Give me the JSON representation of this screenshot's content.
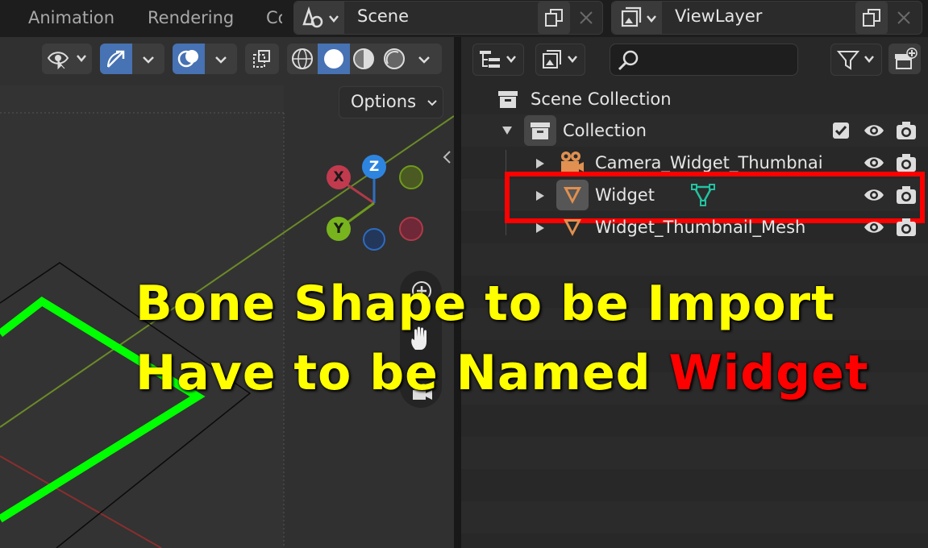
{
  "topbar": {
    "workspace_tabs": [
      "Animation",
      "Rendering",
      "Co"
    ],
    "scene": {
      "icon": "scene-icon",
      "name": "Scene"
    },
    "view_layer": {
      "icon": "view-layer-icon",
      "name": "ViewLayer"
    }
  },
  "viewport": {
    "options_label": "Options",
    "gizmo": {
      "x": "X",
      "y": "Y",
      "z": "Z"
    },
    "colors": {
      "grid_y_axis": "#7a9a2a",
      "grid_x_axis": "#a03030",
      "widget": "#00ff00",
      "active_button": "#4772b3"
    }
  },
  "outliner": {
    "root": "Scene Collection",
    "collection": "Collection",
    "items": [
      {
        "name": "Camera_Widget_Thumbnai",
        "icon": "camera-icon"
      },
      {
        "name": "Widget",
        "icon": "mesh-icon",
        "highlighted": true
      },
      {
        "name": "Widget_Thumbnail_Mesh",
        "icon": "mesh-icon"
      }
    ]
  },
  "caption": {
    "line1": "Bone Shape to be Import",
    "line2_prefix": "Have to be Named ",
    "line2_highlight": "Widget",
    "colors": {
      "text": "#ffff00",
      "highlight": "#ff0000"
    }
  }
}
